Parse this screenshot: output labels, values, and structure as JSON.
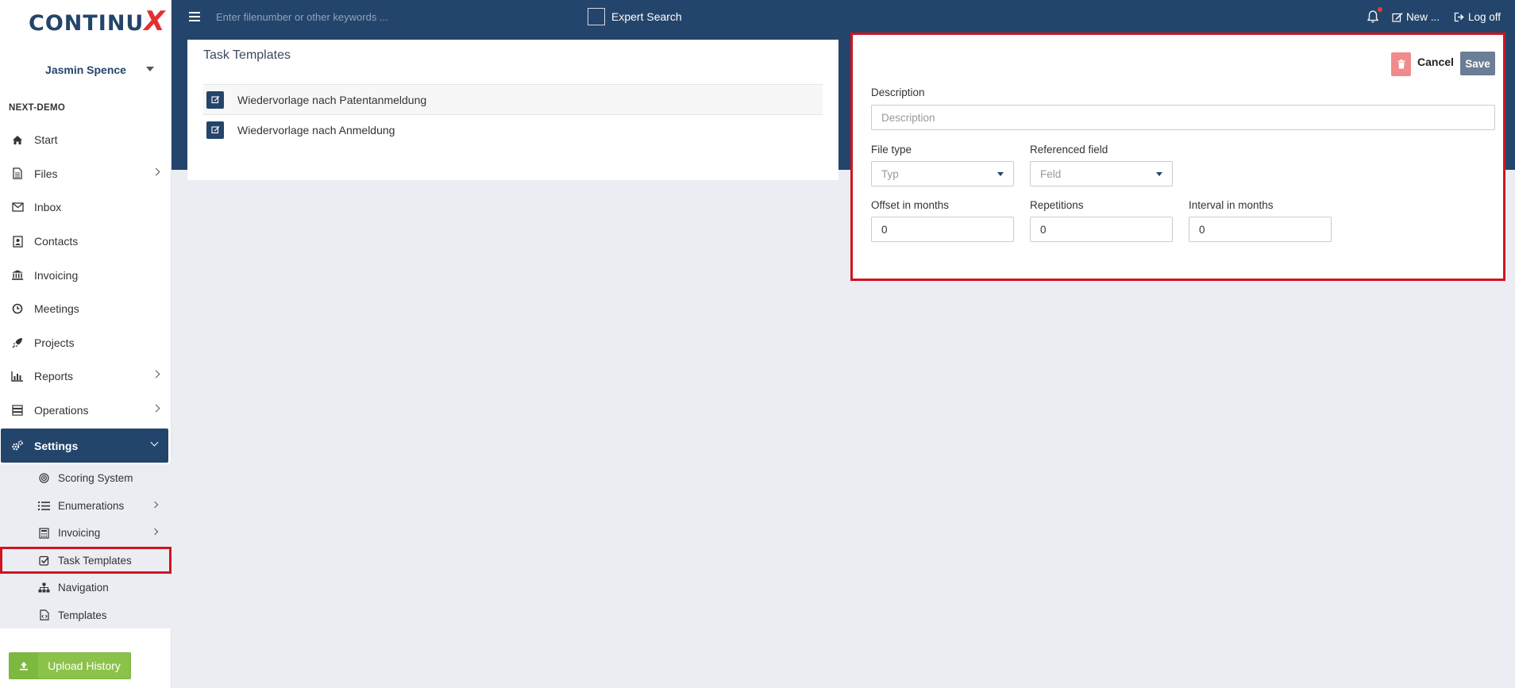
{
  "app": {
    "logo_main": "CONTINU",
    "logo_x": "X",
    "user_name": "Jasmin Spence",
    "org": "NEXT-DEMO"
  },
  "topbar": {
    "search_placeholder": "Enter filenumber or other keywords ...",
    "expert_search": "Expert Search",
    "new_label": "New ...",
    "logoff_label": "Log off"
  },
  "sidebar": {
    "items": [
      {
        "label": "Start",
        "icon": "home-icon"
      },
      {
        "label": "Files",
        "icon": "file-icon"
      },
      {
        "label": "Inbox",
        "icon": "envelope-icon"
      },
      {
        "label": "Contacts",
        "icon": "contact-card-icon"
      },
      {
        "label": "Invoicing",
        "icon": "bank-icon"
      },
      {
        "label": "Meetings",
        "icon": "clock-icon"
      },
      {
        "label": "Projects",
        "icon": "rocket-icon"
      },
      {
        "label": "Reports",
        "icon": "bar-chart-icon"
      },
      {
        "label": "Operations",
        "icon": "server-icon"
      },
      {
        "label": "Settings",
        "icon": "gears-icon"
      }
    ],
    "sub_items": [
      {
        "label": "Scoring System",
        "icon": "bullseye-icon"
      },
      {
        "label": "Enumerations",
        "icon": "list-ol-icon"
      },
      {
        "label": "Invoicing",
        "icon": "calculator-icon"
      },
      {
        "label": "Task Templates",
        "icon": "check-square-icon"
      },
      {
        "label": "Navigation",
        "icon": "sitemap-icon"
      },
      {
        "label": "Templates",
        "icon": "file-code-icon"
      }
    ],
    "upload_label": "Upload History"
  },
  "templates_panel": {
    "title": "Task Templates",
    "rows": [
      "Wiedervorlage nach Patentanmeldung",
      "Wiedervorlage nach Anmeldung"
    ]
  },
  "edit_panel": {
    "cancel_label": "Cancel",
    "save_label": "Save",
    "description_label": "Description",
    "description_placeholder": "Description",
    "file_type_label": "File type",
    "file_type_placeholder": "Typ",
    "referenced_field_label": "Referenced field",
    "referenced_field_placeholder": "Feld",
    "offset_label": "Offset in months",
    "offset_value": "0",
    "repetitions_label": "Repetitions",
    "repetitions_value": "0",
    "interval_label": "Interval in months",
    "interval_value": "0"
  },
  "colors": {
    "brand": "#24456b",
    "accent_red": "#d0141f",
    "upload_green": "#8bc34a"
  }
}
